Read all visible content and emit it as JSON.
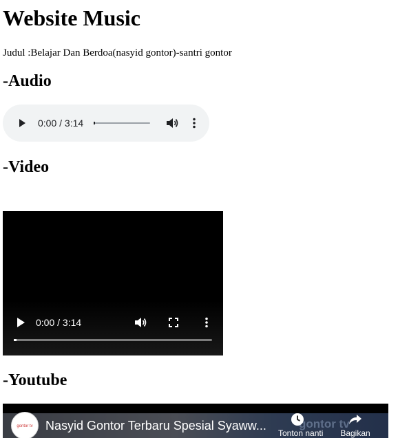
{
  "page": {
    "title": "Website Music",
    "judul": "Judul :Belajar Dan Berdoa(nasyid gontor)-santri gontor"
  },
  "sections": {
    "audio_heading": "-Audio",
    "video_heading": "-Video",
    "youtube_heading": "-Youtube"
  },
  "audio_player": {
    "time_display": "0:00 / 3:14",
    "progress": 0,
    "icons": [
      "play-icon",
      "volume-icon",
      "more-options-icon"
    ]
  },
  "video_player": {
    "time_display": "0:00 / 3:14",
    "progress": 0,
    "icons": [
      "play-icon",
      "volume-icon",
      "fullscreen-icon",
      "more-options-icon"
    ]
  },
  "youtube_embed": {
    "video_title": "Nasyid Gontor Terbaru Spesial Syaww...",
    "channel_watermark": "gontor tv",
    "avatar_text": "gontor tv",
    "watch_later_label": "Tonton nanti",
    "share_label": "Bagikan",
    "icons": [
      "clock-icon",
      "share-arrow-icon"
    ]
  },
  "colors": {
    "audio_bg": "#f1f3f4",
    "video_bg": "#000000",
    "text": "#000000"
  }
}
